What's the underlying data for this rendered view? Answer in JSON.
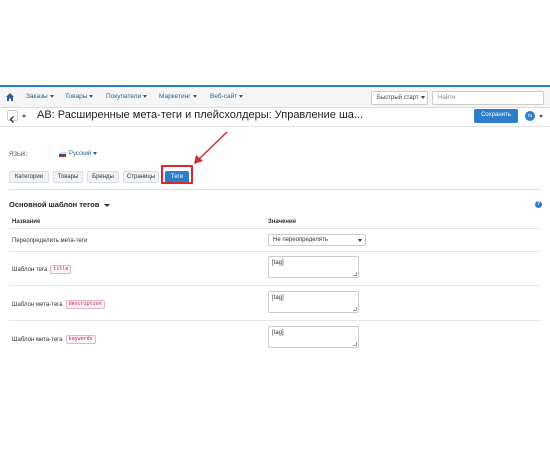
{
  "nav": {
    "items": [
      {
        "label": "Заказы"
      },
      {
        "label": "Товары"
      },
      {
        "label": "Покупатели"
      },
      {
        "label": "Маркетинг"
      },
      {
        "label": "Веб-сайт"
      }
    ],
    "quick_start": "Быстрый старт",
    "search_placeholder": "Найти"
  },
  "header": {
    "title": "AB: Расширенные мета-теги и плейсхолдеры: Управление ша...",
    "save_label": "Сохранить"
  },
  "language": {
    "label": "ЯЗЫК:",
    "value": "Русский"
  },
  "tabs": [
    {
      "label": "Категории",
      "active": false
    },
    {
      "label": "Товары",
      "active": false
    },
    {
      "label": "Бренды",
      "active": false
    },
    {
      "label": "Страницы",
      "active": false
    },
    {
      "label": "Теги",
      "active": true
    }
  ],
  "section": {
    "title": "Основной шаблон тегов",
    "columns": {
      "name": "Название",
      "value": "Значение"
    },
    "rows": [
      {
        "label": "Переопределить мета-теги",
        "code": "",
        "value": "Не переопределять"
      },
      {
        "label": "Шаблон тега",
        "code": "title",
        "value": "[tag]"
      },
      {
        "label": "Шаблон мета-тега",
        "code": "description",
        "value": "[tag]"
      },
      {
        "label": "Шаблон мета-тега",
        "code": "keywords",
        "value": "[tag]"
      }
    ]
  },
  "colors": {
    "accent": "#2b7ec9",
    "highlight": "#d9272e",
    "code_text": "#c7254e"
  },
  "icons": [
    "home-icon",
    "chevron-left-icon",
    "help-icon",
    "flag-ru-icon",
    "red-arrow"
  ]
}
